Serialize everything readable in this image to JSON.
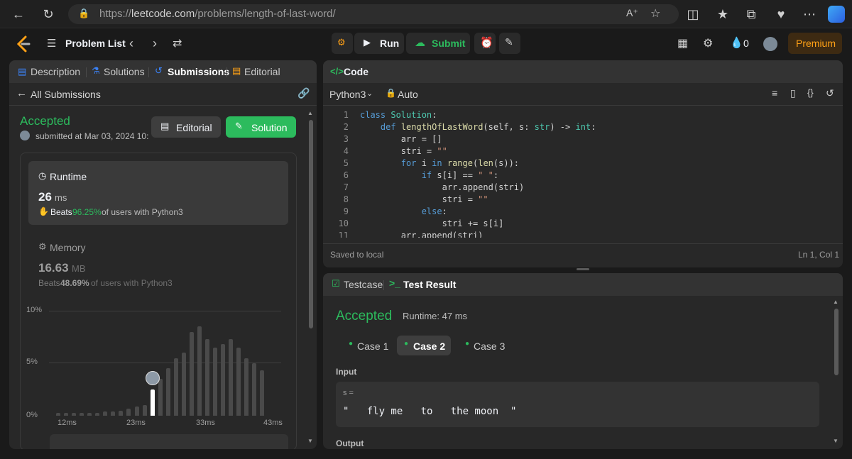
{
  "browser": {
    "url_prefix": "https://",
    "url_domain": "leetcode.com",
    "url_path": "/problems/length-of-last-word/"
  },
  "nav": {
    "problem_list": "Problem List",
    "run": "Run",
    "submit": "Submit",
    "streak_count": "0",
    "premium": "Premium"
  },
  "left_tabs": [
    "Description",
    "Solutions",
    "Submissions",
    "Editorial"
  ],
  "submissions": {
    "back_label": "All Submissions",
    "status": "Accepted",
    "submitted_text": "submitted at Mar 03, 2024 10:",
    "editorial_btn": "Editorial",
    "solution_btn": "Solution"
  },
  "runtime": {
    "title": "Runtime",
    "value": "26",
    "unit": "ms",
    "beats_label": "Beats",
    "beats_pct": "96.25%",
    "beats_suffix": "of users with Python3"
  },
  "memory": {
    "title": "Memory",
    "value": "16.63",
    "unit": "MB",
    "beats_label": "Beats",
    "beats_pct": "48.69%",
    "beats_suffix": "of users with Python3"
  },
  "chart_data": {
    "type": "bar",
    "y_ticks": [
      "10%",
      "5%",
      "0%"
    ],
    "x_ticks": [
      "12ms",
      "23ms",
      "33ms",
      "43ms"
    ],
    "ylim": [
      0,
      10
    ],
    "grid": true,
    "highlight_index": 12,
    "values": [
      0.3,
      0.3,
      0.3,
      0.3,
      0.3,
      0.3,
      0.4,
      0.4,
      0.5,
      0.7,
      0.9,
      1.0,
      2.5,
      3.5,
      4.5,
      5.5,
      6.0,
      8.0,
      8.5,
      7.3,
      6.5,
      6.8,
      7.3,
      6.5,
      5.5,
      5.0,
      4.3
    ]
  },
  "editor": {
    "title": "Code",
    "language": "Python3",
    "mode": "Auto",
    "status": "Saved to local",
    "cursor": "Ln 1, Col 1",
    "lines": [
      "class Solution:",
      "    def lengthOfLastWord(self, s: str) -> int:",
      "        arr = []",
      "        stri = \"\"",
      "        for i in range(len(s)):",
      "            if s[i] == \" \":",
      "                arr.append(stri)",
      "                stri = \"\"",
      "            else:",
      "                stri += s[i]",
      "        arr.append(stri)"
    ]
  },
  "result": {
    "tab_testcase": "Testcase",
    "tab_result": "Test Result",
    "status": "Accepted",
    "runtime": "Runtime: 47 ms",
    "cases": [
      "Case 1",
      "Case 2",
      "Case 3"
    ],
    "input_label": "Input",
    "input_var": "s =",
    "input_value": "\"   fly me   to   the moon  \"",
    "output_label": "Output"
  }
}
